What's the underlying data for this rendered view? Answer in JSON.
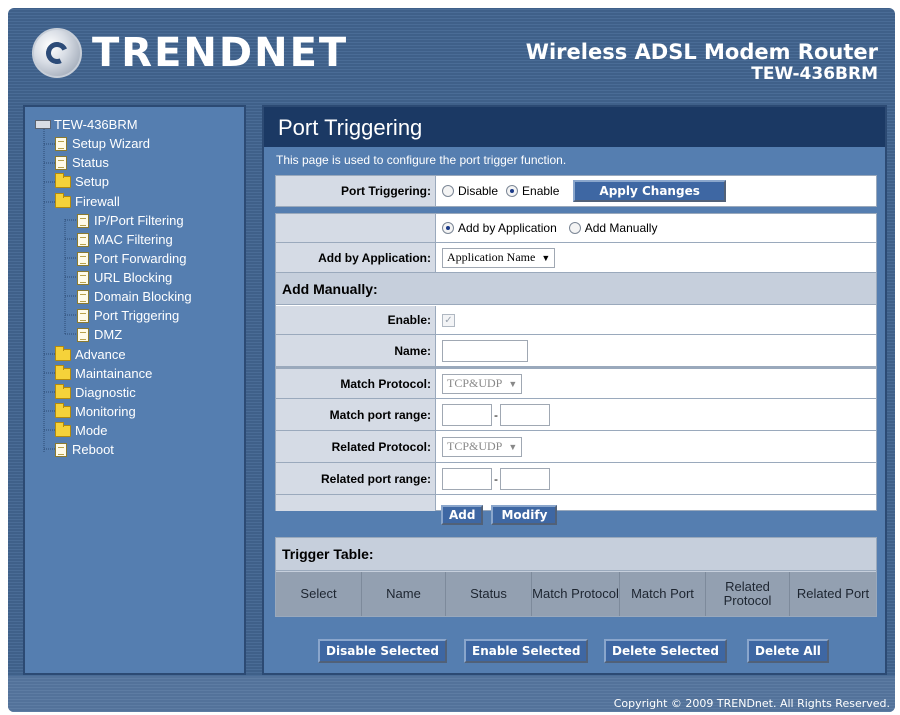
{
  "header": {
    "logo_text": "TRENDNET",
    "product_line": "Wireless ADSL Modem Router",
    "model": "TEW-436BRM"
  },
  "sidebar": {
    "root": "TEW-436BRM",
    "items": [
      {
        "label": "Setup Wizard",
        "icon": "page-icon"
      },
      {
        "label": "Status",
        "icon": "page-icon"
      },
      {
        "label": "Setup",
        "icon": "folder-icon"
      },
      {
        "label": "Firewall",
        "icon": "folder-open-icon"
      },
      {
        "label": "IP/Port Filtering",
        "icon": "page-icon"
      },
      {
        "label": "MAC Filtering",
        "icon": "page-icon"
      },
      {
        "label": "Port Forwarding",
        "icon": "page-icon"
      },
      {
        "label": "URL Blocking",
        "icon": "page-icon"
      },
      {
        "label": "Domain Blocking",
        "icon": "page-icon"
      },
      {
        "label": "Port Triggering",
        "icon": "page-icon"
      },
      {
        "label": "DMZ",
        "icon": "page-icon"
      },
      {
        "label": "Advance",
        "icon": "folder-icon"
      },
      {
        "label": "Maintainance",
        "icon": "folder-icon"
      },
      {
        "label": "Diagnostic",
        "icon": "folder-icon"
      },
      {
        "label": "Monitoring",
        "icon": "folder-icon"
      },
      {
        "label": "Mode",
        "icon": "folder-icon"
      },
      {
        "label": "Reboot",
        "icon": "page-icon"
      }
    ]
  },
  "main": {
    "title": "Port Triggering",
    "intro": "This page is used to configure the port trigger function.",
    "port_triggering": {
      "label": "Port Triggering:",
      "options": [
        "Disable",
        "Enable"
      ],
      "selected": "Enable",
      "apply_button": "Apply Changes"
    },
    "mode": {
      "options": [
        "Add by Application",
        "Add Manually"
      ],
      "selected": "Add by Application"
    },
    "add_by_application": {
      "label": "Add by Application:",
      "selected_value": "Application Name"
    },
    "add_manually": {
      "heading": "Add Manually:",
      "enable_label": "Enable:",
      "enable_checked": true,
      "name_label": "Name:",
      "name_value": "",
      "match_protocol_label": "Match Protocol:",
      "match_protocol_value": "TCP&UDP",
      "match_port_range_label": "Match port range:",
      "match_port_start": "",
      "match_port_end": "",
      "related_protocol_label": "Related Protocol:",
      "related_protocol_value": "TCP&UDP",
      "related_port_range_label": "Related port range:",
      "related_port_start": "",
      "related_port_end": "",
      "range_separator": "-",
      "add_button": "Add",
      "modify_button": "Modify"
    },
    "trigger_table": {
      "heading": "Trigger Table:",
      "columns": [
        "Select",
        "Name",
        "Status",
        "Match Protocol",
        "Match Port",
        "Related Protocol",
        "Related Port"
      ],
      "rows": []
    },
    "actions": {
      "disable_selected": "Disable Selected",
      "enable_selected": "Enable Selected",
      "delete_selected": "Delete Selected",
      "delete_all": "Delete All"
    }
  },
  "footer": {
    "copyright": "Copyright © 2009 TRENDnet. All Rights Reserved."
  }
}
